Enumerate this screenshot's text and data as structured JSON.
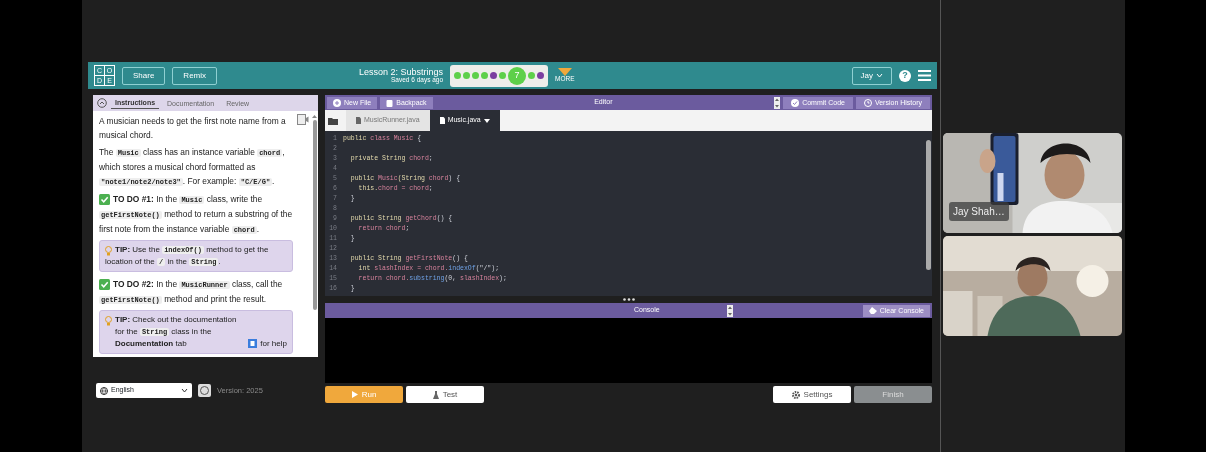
{
  "topbar": {
    "logo_letters": [
      "C",
      "O",
      "D",
      "E"
    ],
    "buttons": [
      "Share",
      "Remix"
    ],
    "lesson_title": "Lesson 2: Substrings",
    "saved": "Saved 6 days ago",
    "progress": [
      {
        "kind": "dot",
        "color": "#5ed04a"
      },
      {
        "kind": "dot",
        "color": "#5ed04a"
      },
      {
        "kind": "dot",
        "color": "#5ed04a"
      },
      {
        "kind": "dot",
        "color": "#5ed04a"
      },
      {
        "kind": "dot",
        "color": "#7b3fa0"
      },
      {
        "kind": "dot",
        "color": "#5ed04a"
      },
      {
        "kind": "current",
        "label": "7",
        "color": "#5ed04a"
      },
      {
        "kind": "dot",
        "color": "#5ed04a"
      },
      {
        "kind": "dot",
        "color": "#7b3fa0"
      }
    ],
    "more": "MORE",
    "user": "Jay",
    "help": "?"
  },
  "instructions_panel": {
    "tabs": [
      {
        "label": "Instructions",
        "selected": true
      },
      {
        "label": "Documentation",
        "selected": false
      },
      {
        "label": "Review",
        "selected": false
      }
    ],
    "blocks": [
      {
        "kind": "para",
        "segments": [
          {
            "kind": "text",
            "text": "A musician needs to get the first note name from a musical chord."
          }
        ]
      },
      {
        "kind": "para",
        "segments": [
          {
            "kind": "text",
            "text": "The "
          },
          {
            "kind": "code",
            "text": "Music"
          },
          {
            "kind": "text",
            "text": " class has an instance variable "
          },
          {
            "kind": "code",
            "text": "chord"
          },
          {
            "kind": "text",
            "text": ", which stores a musical chord formatted as "
          },
          {
            "kind": "code",
            "text": "\"note1/note2/note3\""
          },
          {
            "kind": "text",
            "text": ". For example: "
          },
          {
            "kind": "code",
            "text": "\"C/E/G\""
          },
          {
            "kind": "text",
            "text": "."
          }
        ]
      },
      {
        "kind": "todo",
        "segments": [
          {
            "kind": "bold",
            "text": "TO DO #1:"
          },
          {
            "kind": "text",
            "text": " In the "
          },
          {
            "kind": "code",
            "text": "Music"
          },
          {
            "kind": "text",
            "text": " class, write the "
          },
          {
            "kind": "code",
            "text": "getFirstNote()"
          },
          {
            "kind": "text",
            "text": " method to return a substring of the first note from the instance variable "
          },
          {
            "kind": "code",
            "text": "chord"
          },
          {
            "kind": "text",
            "text": "."
          }
        ]
      },
      {
        "kind": "tip",
        "segments": [
          {
            "kind": "bold",
            "text": "TIP:"
          },
          {
            "kind": "text",
            "text": " Use the "
          },
          {
            "kind": "code",
            "text": "indexOf()"
          },
          {
            "kind": "text",
            "text": " method to get the location of the "
          },
          {
            "kind": "code",
            "text": "/"
          },
          {
            "kind": "text",
            "text": " in the "
          },
          {
            "kind": "code",
            "text": "String"
          },
          {
            "kind": "text",
            "text": "."
          }
        ]
      },
      {
        "kind": "todo",
        "segments": [
          {
            "kind": "bold",
            "text": "TO DO #2:"
          },
          {
            "kind": "text",
            "text": " In the "
          },
          {
            "kind": "code",
            "text": "MusicRunner"
          },
          {
            "kind": "text",
            "text": " class, call the "
          },
          {
            "kind": "code",
            "text": "getFirstNote()"
          },
          {
            "kind": "text",
            "text": " method and print the result."
          }
        ]
      },
      {
        "kind": "tip",
        "segments": [
          {
            "kind": "bold",
            "text": "TIP:"
          },
          {
            "kind": "text",
            "text": " Check out the documentation for the "
          },
          {
            "kind": "code",
            "text": "String"
          },
          {
            "kind": "text",
            "text": " class in the "
          },
          {
            "kind": "bold",
            "text": "Documentation"
          },
          {
            "kind": "text",
            "text": " tab"
          },
          {
            "kind": "icon"
          },
          {
            "kind": "text",
            "text": "for help"
          }
        ]
      }
    ]
  },
  "footer": {
    "language": "English",
    "version": "Version: 2025"
  },
  "editor": {
    "toolbar_buttons": [
      "New File",
      "Backpack"
    ],
    "title": "Editor",
    "actions": [
      "Commit Code",
      "Version History"
    ],
    "files": [
      {
        "name": "MusicRunner.java",
        "selected": false
      },
      {
        "name": "Music.java",
        "selected": true
      }
    ],
    "lines": [
      {
        "n": "1",
        "tokens": [
          {
            "kind": "kw",
            "text": "public "
          },
          {
            "kind": "id",
            "text": "class Music"
          },
          {
            "kind": "plain",
            "text": " {"
          }
        ]
      },
      {
        "n": "2"
      },
      {
        "n": "3",
        "tokens": [
          {
            "kind": "kw",
            "text": "  private String "
          },
          {
            "kind": "id",
            "text": "chord"
          },
          {
            "kind": "plain",
            "text": ";"
          }
        ]
      },
      {
        "n": "4"
      },
      {
        "n": "5",
        "tokens": [
          {
            "kind": "kw",
            "text": "  public "
          },
          {
            "kind": "id",
            "text": "Music"
          },
          {
            "kind": "kw",
            "text": "(String "
          },
          {
            "kind": "id",
            "text": "chord"
          },
          {
            "kind": "plain",
            "text": ") {"
          }
        ]
      },
      {
        "n": "6",
        "tokens": [
          {
            "kind": "kw",
            "text": "    this."
          },
          {
            "kind": "id",
            "text": "chord = chord"
          },
          {
            "kind": "plain",
            "text": ";"
          }
        ]
      },
      {
        "n": "7",
        "tokens": [
          {
            "kind": "plain",
            "text": "  }"
          }
        ]
      },
      {
        "n": "8"
      },
      {
        "n": "9",
        "tokens": [
          {
            "kind": "kw",
            "text": "  public String "
          },
          {
            "kind": "id",
            "text": "getChord"
          },
          {
            "kind": "plain",
            "text": "() {"
          }
        ]
      },
      {
        "n": "10",
        "tokens": [
          {
            "kind": "id",
            "text": "    return chord"
          },
          {
            "kind": "plain",
            "text": ";"
          }
        ]
      },
      {
        "n": "11",
        "tokens": [
          {
            "kind": "plain",
            "text": "  }"
          }
        ]
      },
      {
        "n": "12"
      },
      {
        "n": "13",
        "tokens": [
          {
            "kind": "kw",
            "text": "  public String "
          },
          {
            "kind": "id",
            "text": "getFirstNote"
          },
          {
            "kind": "plain",
            "text": "() {"
          }
        ]
      },
      {
        "n": "14",
        "tokens": [
          {
            "kind": "kw",
            "text": "    int "
          },
          {
            "kind": "id",
            "text": "slashIndex = chord."
          },
          {
            "kind": "fn",
            "text": "indexOf"
          },
          {
            "kind": "plain",
            "text": "(\"/\");"
          }
        ]
      },
      {
        "n": "15",
        "tokens": [
          {
            "kind": "id",
            "text": "    return chord."
          },
          {
            "kind": "fn",
            "text": "substring"
          },
          {
            "kind": "plain",
            "text": "(0, "
          },
          {
            "kind": "id",
            "text": "slashIndex"
          },
          {
            "kind": "plain",
            "text": ");"
          }
        ]
      },
      {
        "n": "16",
        "tokens": [
          {
            "kind": "plain",
            "text": "  }"
          }
        ]
      }
    ]
  },
  "console": {
    "title": "Console",
    "clear": "Clear Console"
  },
  "bottom_buttons": [
    {
      "kind": "run",
      "label": "Run"
    },
    {
      "kind": "test",
      "label": "Test"
    },
    {
      "kind": "settings",
      "label": "Settings"
    },
    {
      "kind": "finish",
      "label": "Finish"
    }
  ],
  "video_tiles": [
    {
      "kind": "picture",
      "name_tag": "Jay Shah…"
    },
    {
      "kind": "picture"
    }
  ]
}
